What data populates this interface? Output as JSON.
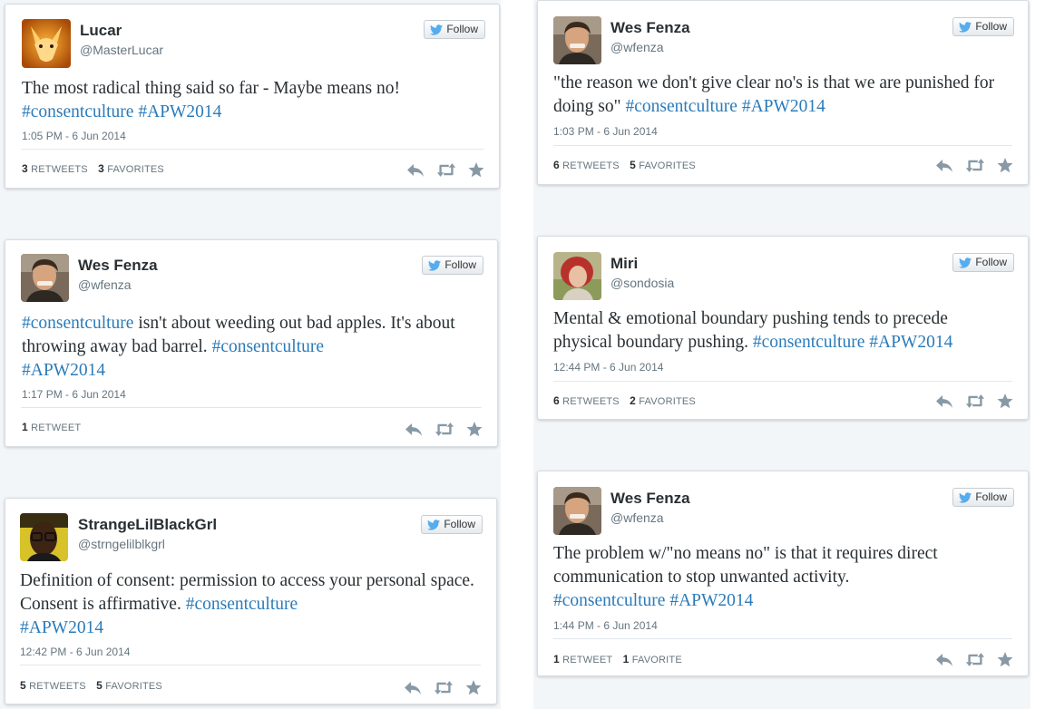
{
  "follow_label": "Follow",
  "colors": {
    "hashtag": "#2b7bb9",
    "text": "#292f33",
    "meta": "#66757f",
    "twitter_bird": "#55acee"
  },
  "tweets": [
    {
      "name": "Lucar",
      "handle": "@MasterLucar",
      "avatar_icon": "fox-avatar",
      "text_parts": [
        "The most radical thing said so far - Maybe means no!",
        " #consentculture",
        " #APW2014"
      ],
      "time": "1:05 PM - 6 Jun 2014",
      "stat1_count": "3",
      "stat1_label": " RETWEETS",
      "stat2_count": "3",
      "stat2_label": " FAVORITES"
    },
    {
      "name": "Wes Fenza",
      "handle": "@wfenza",
      "avatar_icon": "man-portrait-avatar",
      "text_parts": [
        "#consentculture",
        " isn't about weeding out bad apples. It's about throwing away bad barrel. ",
        "#consentculture",
        " #APW2014"
      ],
      "time": "1:17 PM - 6 Jun 2014",
      "stat1_count": "1",
      "stat1_label": " RETWEET",
      "stat2_count": "",
      "stat2_label": ""
    },
    {
      "name": "StrangeLilBlackGrl",
      "handle": "@strngelilblkgrl",
      "avatar_icon": "woman-glasses-avatar",
      "text_parts": [
        "Definition of consent: permission to access your personal space. Consent is affirmative. ",
        "#consentculture",
        " #APW2014"
      ],
      "time": "12:42 PM - 6 Jun 2014",
      "stat1_count": "5",
      "stat1_label": " RETWEETS",
      "stat2_count": "5",
      "stat2_label": " FAVORITES"
    },
    {
      "name": "Wes Fenza",
      "handle": "@wfenza",
      "avatar_icon": "man-portrait-avatar",
      "text_parts": [
        "\"the reason we don't give clear no's is that we are punished for doing so\" ",
        "#consentculture",
        " #APW2014"
      ],
      "time": "1:03 PM - 6 Jun 2014",
      "stat1_count": "6",
      "stat1_label": " RETWEETS",
      "stat2_count": "5",
      "stat2_label": " FAVORITES"
    },
    {
      "name": "Miri",
      "handle": "@sondosia",
      "avatar_icon": "red-hair-woman-avatar",
      "text_parts": [
        "Mental & emotional boundary pushing tends to precede physical boundary pushing. ",
        "#consentculture",
        " #APW2014"
      ],
      "time": "12:44 PM - 6 Jun 2014",
      "stat1_count": "6",
      "stat1_label": " RETWEETS",
      "stat2_count": "2",
      "stat2_label": " FAVORITES"
    },
    {
      "name": "Wes Fenza",
      "handle": "@wfenza",
      "avatar_icon": "man-portrait-avatar",
      "text_parts": [
        "The problem w/\"no means no\" is that it requires direct communication to stop unwanted activity. ",
        "#consentculture",
        " #APW2014"
      ],
      "time": "1:44 PM - 6 Jun 2014",
      "stat1_count": "1",
      "stat1_label": " RETWEET",
      "stat2_count": "1",
      "stat2_label": " FAVORITE"
    }
  ]
}
